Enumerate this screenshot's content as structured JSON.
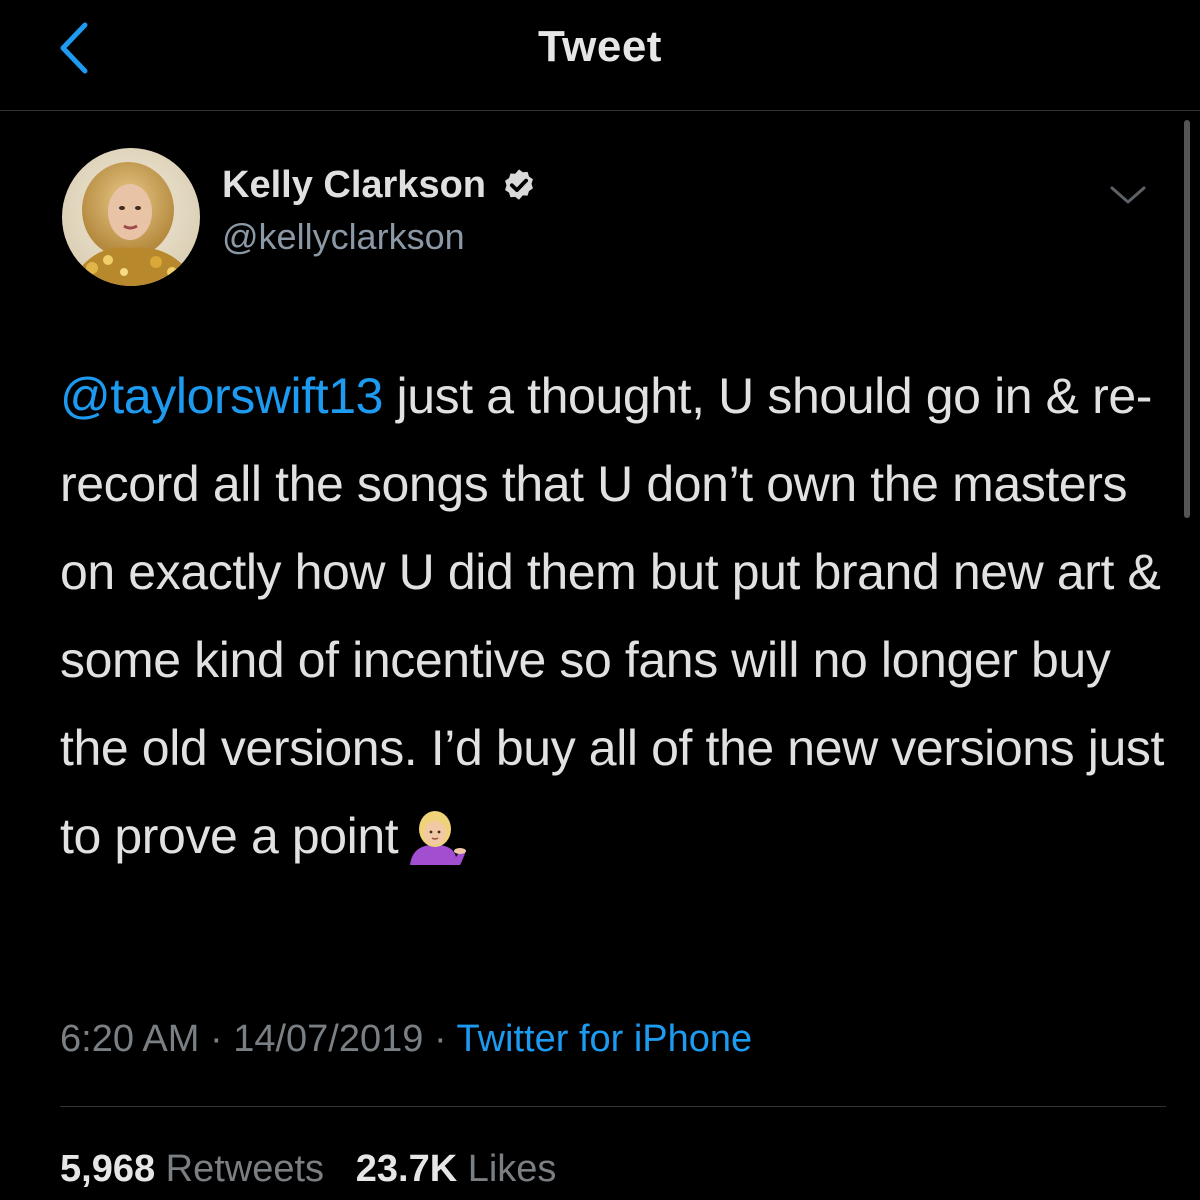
{
  "header": {
    "title": "Tweet",
    "back_icon": "chevron-left-icon",
    "accent_color": "#1d9bf0"
  },
  "author": {
    "name": "Kelly Clarkson",
    "handle": "@kellyclarkson",
    "verified": true,
    "verified_icon": "verified-badge-icon"
  },
  "tweet": {
    "mention": "@taylorswift13",
    "text": " just a thought, U should go in & re-record all the songs that U don’t own the masters on exactly how U did them but put brand new art & some kind of incentive so fans will no longer buy the old versions. I’d buy all of the new versions just to prove a point",
    "emoji": "person-tipping-hand-emoji"
  },
  "meta": {
    "time": "6:20 AM",
    "separator": "·",
    "date": "14/07/2019",
    "source": "Twitter for iPhone"
  },
  "stats": {
    "retweets_count": "5,968",
    "retweets_label": "Retweets",
    "likes_count": "23.7K",
    "likes_label": "Likes"
  },
  "colors": {
    "background": "#000000",
    "link": "#1d9bf0",
    "secondary_text": "#7a7f84"
  }
}
